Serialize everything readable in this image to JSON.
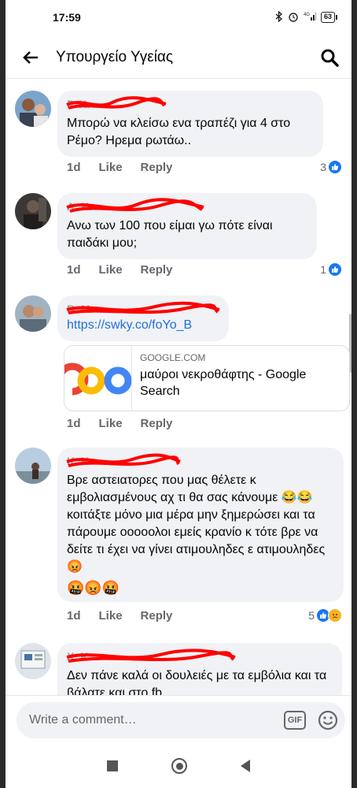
{
  "status_bar": {
    "time": "17:59",
    "battery": "63",
    "signal": "4G"
  },
  "header": {
    "title": "Υπουργείο Υγείας"
  },
  "comments": [
    {
      "author": "Ρ. Κ.",
      "text": "Μπορώ να κλείσω ενα τραπέζι για 4 στο Ρέμο? Ηρεμα ρωτάω..",
      "time": "1d",
      "like_label": "Like",
      "reply_label": "Reply",
      "reaction_count": "3"
    },
    {
      "author": "Α. Κ.",
      "text": "Ανω των 100 που είμαι γω πότε είναι παιδάκι μου;",
      "time": "1d",
      "like_label": "Like",
      "reply_label": "Reply",
      "reaction_count": "1"
    },
    {
      "author": "Β. Μ.",
      "link_text": "https://swky.co/foYo_B",
      "link_preview": {
        "domain": "GOOGLE.COM",
        "title": "μαύροι νεκροθάφτης - Google Search"
      },
      "time": "1d",
      "like_label": "Like",
      "reply_label": "Reply"
    },
    {
      "author": "Κ. Κ.",
      "text": "Βρε αστειατορες που μας θέλετε κ εμβολιασμένους αχ τι θα σας κάνουμε 😂😂 κοιτάξτε μόνο μια μέρα μην ξημερώσει και τα πάρουμε οοοοολοι εμείς κρανίο κ τότε βρε να δείτε τι έχει να γίνει ατιμουληδες ε ατιμουληδες 😡",
      "emoji_line": "🤬😡🤬",
      "time": "1d",
      "like_label": "Like",
      "reply_label": "Reply",
      "reaction_count": "5"
    },
    {
      "author": "Χ. Κ.",
      "text": "Δεν πάνε καλά οι δουλειές με τα εμβόλια και τα βάλατε και στο fb"
    }
  ],
  "composer": {
    "placeholder": "Write a comment…",
    "gif_label": "GIF"
  },
  "colors": {
    "link": "#216fdb",
    "like_blue": "#1877f2",
    "scribble_red": "#ff0000"
  }
}
